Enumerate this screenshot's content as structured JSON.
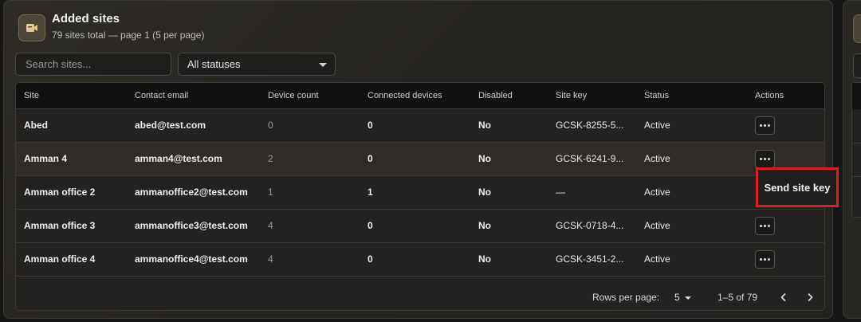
{
  "header": {
    "title": "Added sites",
    "subtitle": "79 sites total — page 1 (5 per page)",
    "icon": "video-camera-icon"
  },
  "filters": {
    "search_placeholder": "Search sites...",
    "status_selected": "All statuses"
  },
  "table": {
    "columns": [
      "Site",
      "Contact email",
      "Device count",
      "Connected devices",
      "Disabled",
      "Site key",
      "Status",
      "Actions"
    ],
    "rows": [
      {
        "site": "Abed",
        "email": "abed@test.com",
        "device_count": "0",
        "connected": "0",
        "disabled": "No",
        "site_key": "GCSK-8255-5...",
        "status": "Active"
      },
      {
        "site": "Amman 4",
        "email": "amman4@test.com",
        "device_count": "2",
        "connected": "0",
        "disabled": "No",
        "site_key": "GCSK-6241-9...",
        "status": "Active"
      },
      {
        "site": "Amman office 2",
        "email": "ammanoffice2@test.com",
        "device_count": "1",
        "connected": "1",
        "disabled": "No",
        "site_key": "—",
        "status": "Active"
      },
      {
        "site": "Amman office 3",
        "email": "ammanoffice3@test.com",
        "device_count": "4",
        "connected": "0",
        "disabled": "No",
        "site_key": "GCSK-0718-4...",
        "status": "Active"
      },
      {
        "site": "Amman office 4",
        "email": "ammanoffice4@test.com",
        "device_count": "4",
        "connected": "0",
        "disabled": "No",
        "site_key": "GCSK-3451-2...",
        "status": "Active"
      }
    ]
  },
  "pagination": {
    "rows_per_page_label": "Rows per page:",
    "rows_per_page_value": "5",
    "range": "1–5 of 79"
  },
  "popup": {
    "label": "Send site key"
  },
  "colors": {
    "highlight_border": "#d91f26",
    "accent_icon_bg": "#4c4538"
  }
}
